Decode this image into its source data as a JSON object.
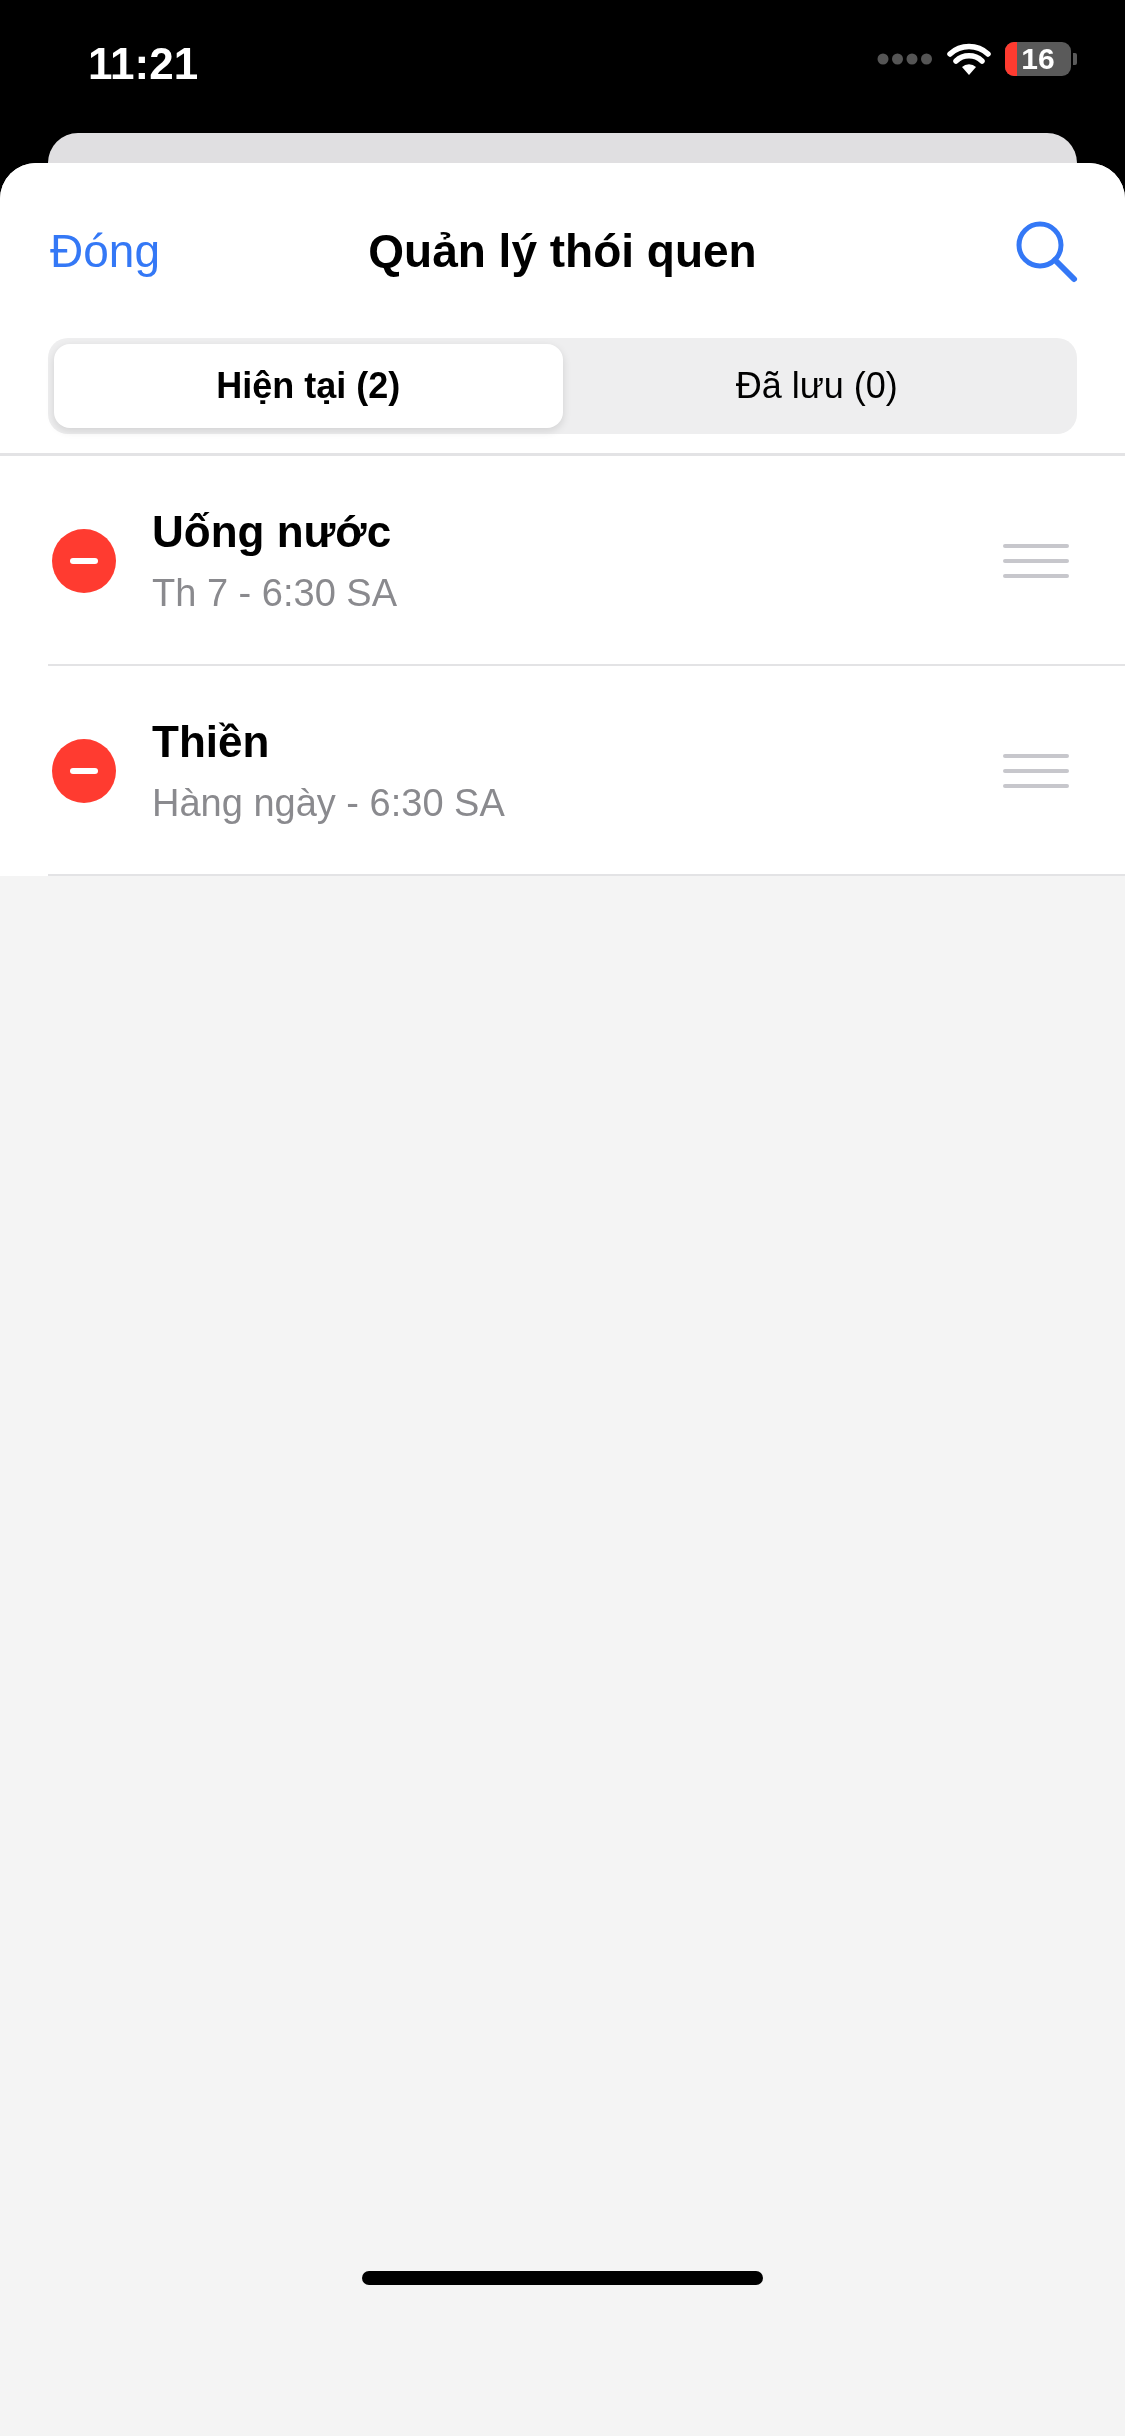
{
  "status_bar": {
    "time": "11:21",
    "battery": "16"
  },
  "nav": {
    "close": "Đóng",
    "title": "Quản lý thói quen"
  },
  "tabs": [
    {
      "label": "Hiện tại (2)",
      "selected": true
    },
    {
      "label": "Đã lưu (0)",
      "selected": false
    }
  ],
  "habits": [
    {
      "name": "Uống nước",
      "schedule": "Th 7 - 6:30 SA"
    },
    {
      "name": "Thiền",
      "schedule": "Hàng ngày - 6:30 SA"
    }
  ]
}
